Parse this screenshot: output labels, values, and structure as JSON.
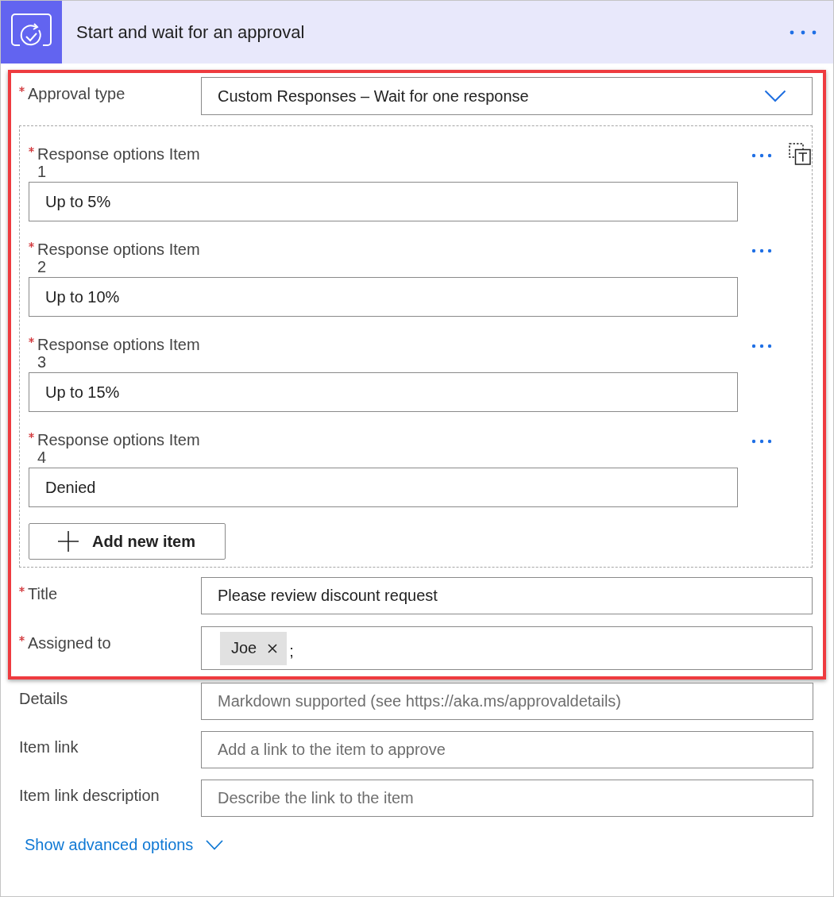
{
  "card": {
    "title": "Start and wait for an approval"
  },
  "highlighted_section": {
    "highlighted": true,
    "approval_type": {
      "label": "Approval type",
      "required": true,
      "value": "Custom Responses – Wait for one response"
    },
    "response_options": {
      "items": [
        {
          "label": "Response options Item 1",
          "required": true,
          "value": "Up to 5%"
        },
        {
          "label": "Response options Item 2",
          "required": true,
          "value": "Up to 10%"
        },
        {
          "label": "Response options Item 3",
          "required": true,
          "value": "Up to 15%"
        },
        {
          "label": "Response options Item 4",
          "required": true,
          "value": "Denied"
        }
      ],
      "add_button": "Add new item"
    },
    "title_field": {
      "label": "Title",
      "required": true,
      "value": "Please review discount request"
    },
    "assigned_to": {
      "label": "Assigned to",
      "required": true,
      "tokens": [
        {
          "name": "Joe"
        }
      ],
      "separator": ";"
    }
  },
  "optional_fields": [
    {
      "label": "Details",
      "required": false,
      "placeholder": "Markdown supported (see https://aka.ms/approvaldetails)"
    },
    {
      "label": "Item link",
      "required": false,
      "placeholder": "Add a link to the item to approve"
    },
    {
      "label": "Item link description",
      "required": false,
      "placeholder": "Describe the link to the item"
    }
  ],
  "advanced_options": {
    "label": "Show advanced options",
    "expanded": false
  }
}
